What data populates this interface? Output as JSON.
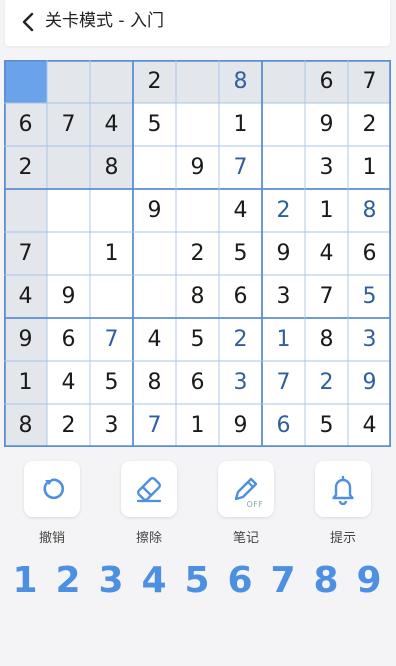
{
  "header": {
    "title": "关卡模式 - 入门",
    "back_icon": "chevron-left-icon"
  },
  "colors": {
    "accent": "#4d8fe0",
    "selected": "#6aa3ea",
    "highlight": "#e3e6eb",
    "entered": "#2f5fa0",
    "grid": "#a7c3e8"
  },
  "board": {
    "rows": [
      [
        "",
        "",
        "",
        "2",
        "",
        "8",
        "",
        "6",
        "7"
      ],
      [
        "6",
        "7",
        "4",
        "5",
        "",
        "1",
        "",
        "9",
        "2"
      ],
      [
        "2",
        "",
        "8",
        "",
        "9",
        "7",
        "",
        "3",
        "1"
      ],
      [
        "",
        "",
        "",
        "9",
        "",
        "4",
        "2",
        "1",
        "8"
      ],
      [
        "7",
        "",
        "1",
        "",
        "2",
        "5",
        "9",
        "4",
        "6"
      ],
      [
        "4",
        "9",
        "",
        "",
        "8",
        "6",
        "3",
        "7",
        "5"
      ],
      [
        "9",
        "6",
        "7",
        "4",
        "5",
        "2",
        "1",
        "8",
        "3"
      ],
      [
        "1",
        "4",
        "5",
        "8",
        "6",
        "3",
        "7",
        "2",
        "9"
      ],
      [
        "8",
        "2",
        "3",
        "7",
        "1",
        "9",
        "6",
        "5",
        "4"
      ]
    ],
    "entered": [
      [
        0,
        5
      ],
      [
        2,
        5
      ],
      [
        3,
        6
      ],
      [
        3,
        8
      ],
      [
        5,
        8
      ],
      [
        6,
        2
      ],
      [
        6,
        5
      ],
      [
        6,
        6
      ],
      [
        6,
        8
      ],
      [
        7,
        5
      ],
      [
        7,
        6
      ],
      [
        7,
        7
      ],
      [
        7,
        8
      ],
      [
        8,
        3
      ],
      [
        8,
        6
      ]
    ],
    "selected": [
      0,
      0
    ]
  },
  "tools": [
    {
      "label": "撤销",
      "icon": "undo-icon"
    },
    {
      "label": "擦除",
      "icon": "eraser-icon"
    },
    {
      "label": "笔记",
      "icon": "pencil-icon",
      "badge": "OFF"
    },
    {
      "label": "提示",
      "icon": "bell-icon"
    }
  ],
  "numbers": [
    "1",
    "2",
    "3",
    "4",
    "5",
    "6",
    "7",
    "8",
    "9"
  ]
}
